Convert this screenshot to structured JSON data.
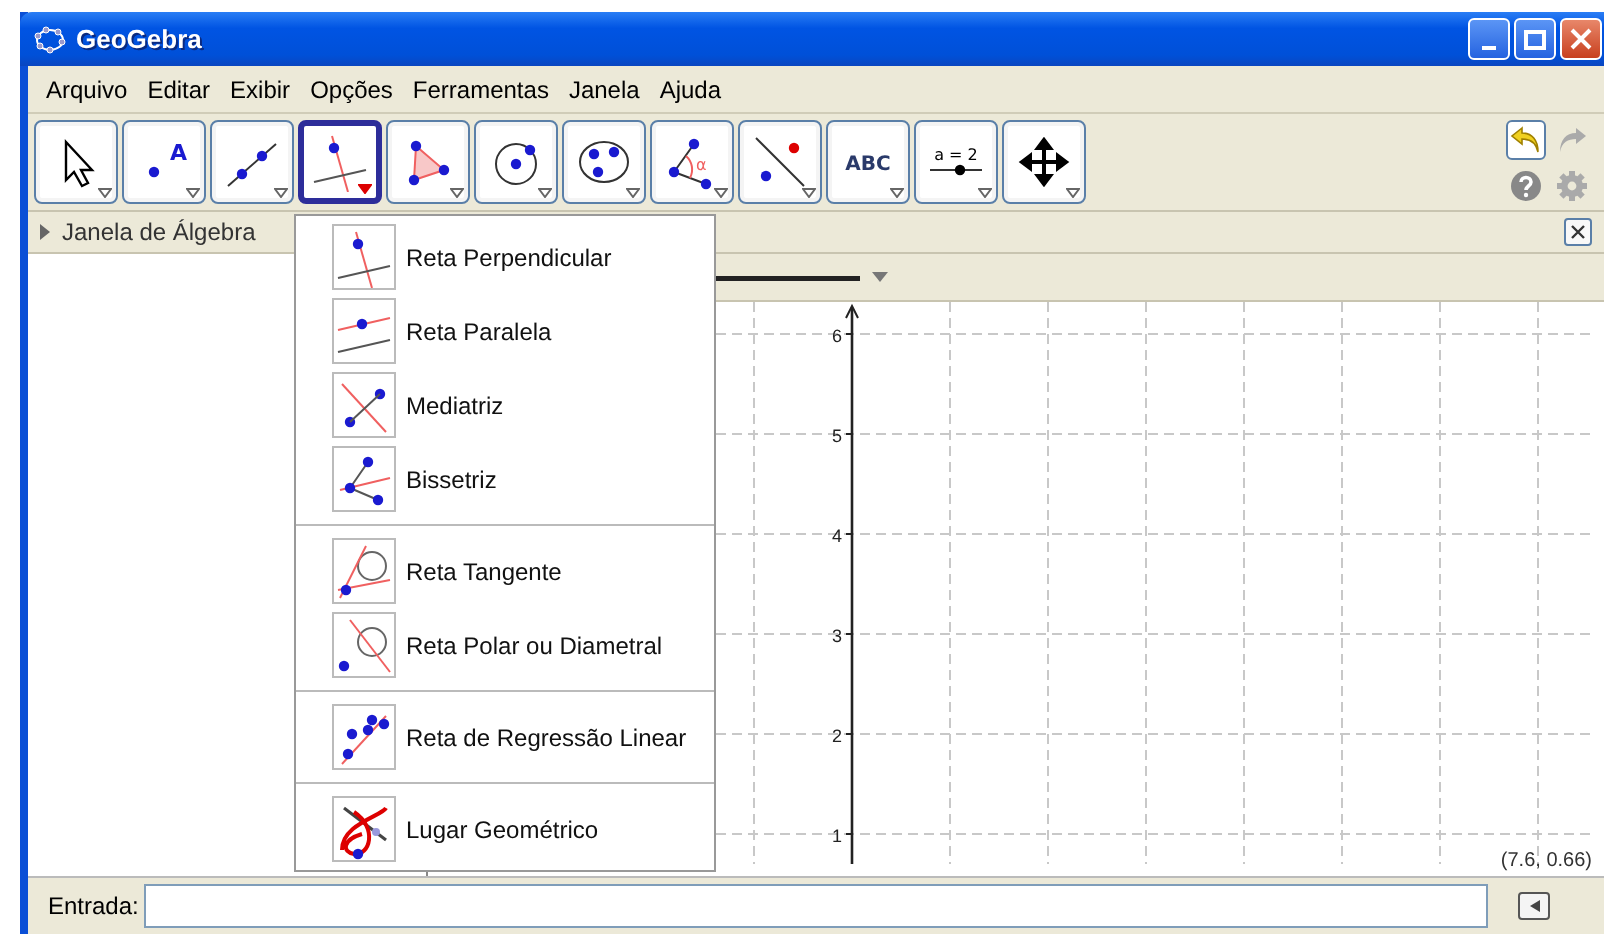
{
  "window": {
    "title": "GeoGebra"
  },
  "menu": [
    "Arquivo",
    "Editar",
    "Exibir",
    "Opções",
    "Ferramentas",
    "Janela",
    "Ajuda"
  ],
  "tools": [
    {
      "kind": "move",
      "selected": false
    },
    {
      "kind": "point",
      "label": "A",
      "selected": false
    },
    {
      "kind": "line",
      "selected": false
    },
    {
      "kind": "perpendicular",
      "selected": true
    },
    {
      "kind": "polygon",
      "selected": false
    },
    {
      "kind": "circle",
      "selected": false
    },
    {
      "kind": "conic",
      "selected": false
    },
    {
      "kind": "angle",
      "label": "α",
      "selected": false
    },
    {
      "kind": "reflect",
      "selected": false
    },
    {
      "kind": "text",
      "label": "ABC",
      "selected": false
    },
    {
      "kind": "slider",
      "label": "a = 2",
      "selected": false
    },
    {
      "kind": "pan",
      "selected": false
    }
  ],
  "algebra_header": {
    "title": "Janela de Álgebra"
  },
  "tool_menu": [
    [
      {
        "kind": "perpendicular",
        "label": "Reta Perpendicular"
      },
      {
        "kind": "parallel",
        "label": "Reta Paralela"
      },
      {
        "kind": "bisector",
        "label": "Mediatriz"
      },
      {
        "kind": "anglebisector",
        "label": "Bissetriz"
      }
    ],
    [
      {
        "kind": "tangent",
        "label": "Reta Tangente"
      },
      {
        "kind": "polar",
        "label": "Reta Polar ou Diametral"
      }
    ],
    [
      {
        "kind": "regression",
        "label": "Reta de Regressão Linear"
      }
    ],
    [
      {
        "kind": "locus",
        "label": "Lugar Geométrico"
      }
    ]
  ],
  "graphics": {
    "y_ticks": [
      "6",
      "5",
      "4",
      "3",
      "2",
      "1"
    ],
    "coordinates": "(7.6, 0.66)"
  },
  "input_bar": {
    "label": "Entrada:"
  }
}
